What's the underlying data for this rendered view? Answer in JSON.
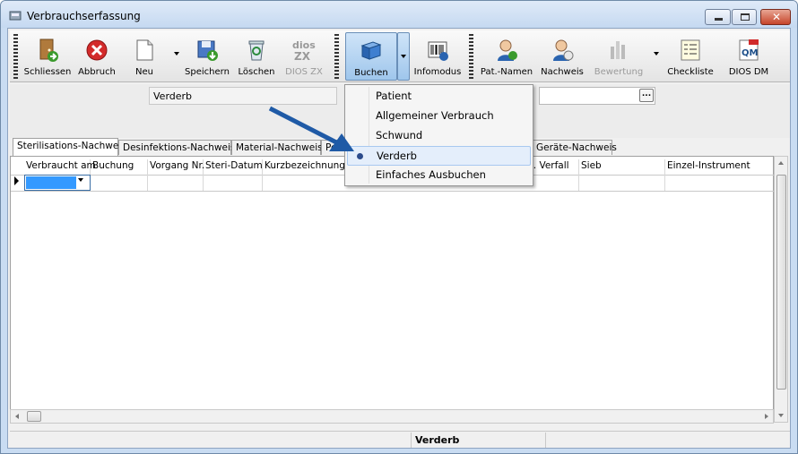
{
  "window": {
    "title": "Verbrauchserfassung",
    "min_label": "–",
    "max_label": "□",
    "close_label": "✕"
  },
  "toolbar": {
    "items": [
      {
        "label": "Schliessen",
        "icon": "door-exit-icon"
      },
      {
        "label": "Abbruch",
        "icon": "cancel-icon"
      },
      {
        "label": "Neu",
        "icon": "new-document-icon"
      },
      {
        "label": "Speichern",
        "icon": "save-disk-icon"
      },
      {
        "label": "Löschen",
        "icon": "recycle-bin-icon"
      },
      {
        "label": "DIOS ZX",
        "icon": "dios-zx-logo-icon"
      },
      {
        "label": "Buchen",
        "icon": "book-icon"
      },
      {
        "label": "Infomodus",
        "icon": "barcode-icon"
      },
      {
        "label": "Pat.-Namen",
        "icon": "patient-user-icon"
      },
      {
        "label": "Nachweis",
        "icon": "nachweis-user-icon"
      },
      {
        "label": "Bewertung",
        "icon": "bewertung-icon"
      },
      {
        "label": "Checkliste",
        "icon": "checklist-icon"
      },
      {
        "label": "DIOS DM",
        "icon": "dios-dm-pdf-icon"
      }
    ]
  },
  "panel": {
    "field_value": "Verderb",
    "ellipsis_label": "..."
  },
  "tabs": [
    "Sterilisations-Nachweis",
    "Desinfektions-Nachweis",
    "Material-Nachweis",
    "Pers",
    "Geräte-Nachweis"
  ],
  "grid": {
    "columns": [
      "Verbraucht am",
      "Buchung",
      "Vorgang Nr.",
      "Steri-Datum",
      "Kurzbezeichnung",
      "nt. Verfall",
      "Sieb",
      "Einzel-Instrument"
    ]
  },
  "menu": {
    "items": [
      {
        "label": "Patient",
        "selected": false
      },
      {
        "label": "Allgemeiner Verbrauch",
        "selected": false
      },
      {
        "label": "Schwund",
        "selected": false
      },
      {
        "label": "Verderb",
        "selected": true
      },
      {
        "label": "Einfaches Ausbuchen",
        "selected": false
      }
    ]
  },
  "status": {
    "mode": "Verderb"
  },
  "colors": {
    "accent": "#3399ff",
    "arrow": "#1f5aa6",
    "titlebar": "#c5d9f1"
  }
}
